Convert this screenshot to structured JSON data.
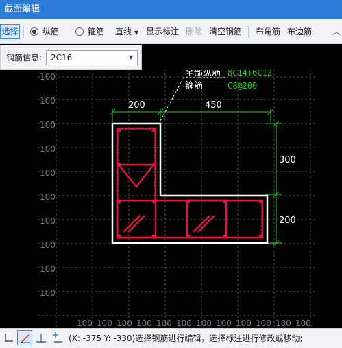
{
  "window": {
    "title": "截面编辑"
  },
  "toolbar": {
    "select": "选择",
    "longitudinal": "纵筋",
    "stirrup": "箍筋",
    "line": "直线",
    "show_dims": "显示标注",
    "delete": "删除",
    "clear": "清空钢筋",
    "corner": "布角筋",
    "edge": "布边筋",
    "collapse": "︿"
  },
  "info": {
    "label": "钢筋信息:",
    "value": "2C16"
  },
  "annotation": {
    "all_long_label": "全部纵筋",
    "all_long_value": "8C14+6C12",
    "stirrup_label": "箍筋",
    "stirrup_value": "C8@200"
  },
  "dims": {
    "top_left": "200",
    "top_right": "450",
    "right_upper": "300",
    "right_lower": "200"
  },
  "grid_label": "100",
  "status": {
    "text": "(X: -375 Y: -330)选择钢筋进行编辑，选择标注进行修改或移动;"
  },
  "colors": {
    "rebar": "#e0143c",
    "outline": "#ffffff",
    "dimension": "#19d219",
    "grid": "#555555",
    "accent": "#2d7cd6"
  }
}
